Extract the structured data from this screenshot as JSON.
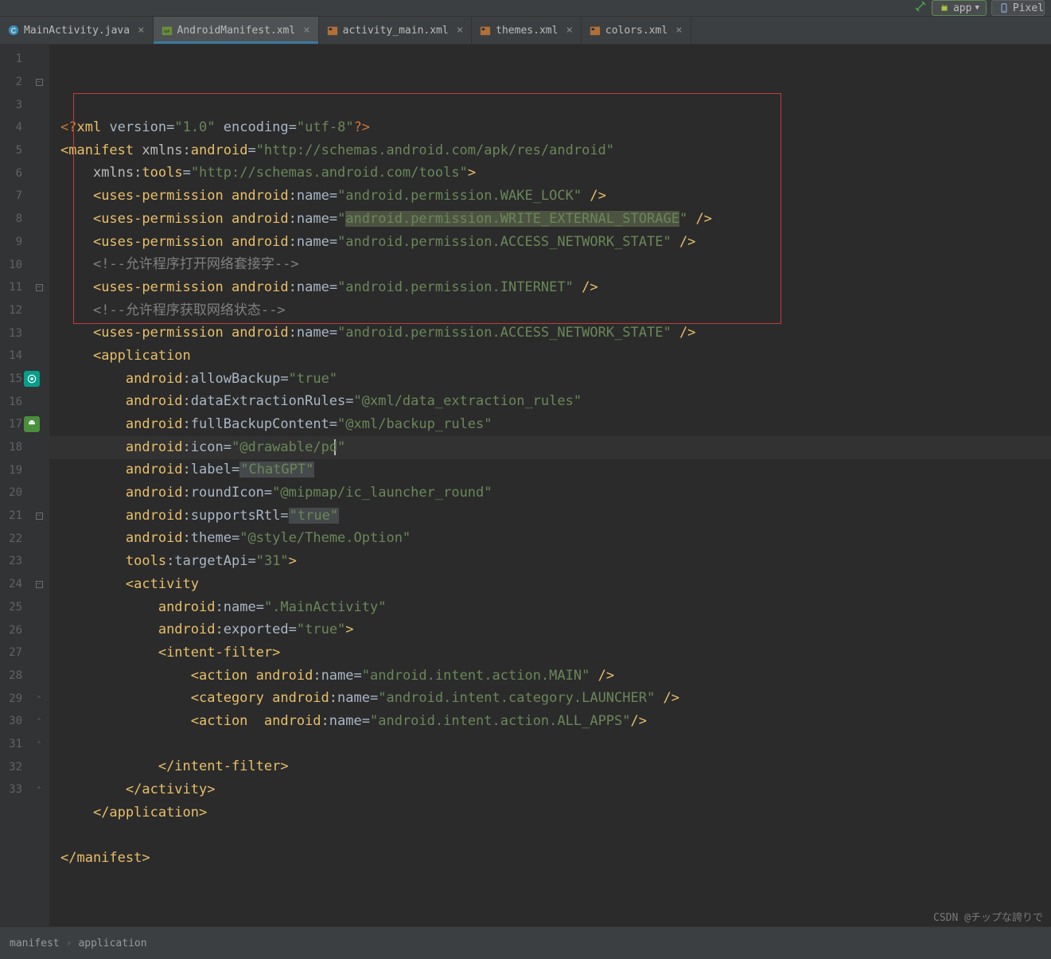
{
  "toolbar": {
    "config_label": "app",
    "device_label": "Pixel"
  },
  "tabs": [
    {
      "name": "MainActivity.java",
      "active": false
    },
    {
      "name": "AndroidManifest.xml",
      "active": true
    },
    {
      "name": "activity_main.xml",
      "active": false
    },
    {
      "name": "themes.xml",
      "active": false
    },
    {
      "name": "colors.xml",
      "active": false
    }
  ],
  "breadcrumb": [
    "manifest",
    "application"
  ],
  "watermark": "CSDN @チップな誇りで",
  "code": {
    "lines": [
      {
        "n": "1",
        "seg": [
          {
            "c": "decl",
            "t": "<?"
          },
          {
            "c": "tag",
            "t": "xml "
          },
          {
            "c": "attr",
            "t": "version"
          },
          {
            "c": "op",
            "t": "="
          },
          {
            "c": "str",
            "t": "\"1.0\""
          },
          {
            "c": "attr",
            "t": " encoding"
          },
          {
            "c": "op",
            "t": "="
          },
          {
            "c": "str",
            "t": "\"utf-8\""
          },
          {
            "c": "decl",
            "t": "?>"
          }
        ]
      },
      {
        "n": "2",
        "fold": "-",
        "seg": [
          {
            "c": "tag",
            "t": "<manifest "
          },
          {
            "c": "ns",
            "t": "xmlns:"
          },
          {
            "c": "tag",
            "t": "android"
          },
          {
            "c": "op",
            "t": "="
          },
          {
            "c": "str",
            "t": "\"http://schemas.android.com/apk/res/android\""
          }
        ]
      },
      {
        "n": "3",
        "seg": [
          {
            "c": "op",
            "t": "    "
          },
          {
            "c": "ns",
            "t": "xmlns:"
          },
          {
            "c": "tag",
            "t": "tools"
          },
          {
            "c": "op",
            "t": "="
          },
          {
            "c": "str",
            "t": "\"http://schemas.android.com/tools\""
          },
          {
            "c": "tag",
            "t": ">"
          }
        ]
      },
      {
        "n": "4",
        "seg": [
          {
            "c": "op",
            "t": "    "
          },
          {
            "c": "tag",
            "t": "<uses-permission "
          },
          {
            "c": "tag",
            "t": "android"
          },
          {
            "c": "ns",
            "t": ":"
          },
          {
            "c": "attr",
            "t": "name"
          },
          {
            "c": "op",
            "t": "="
          },
          {
            "c": "str",
            "t": "\"android.permission.WAKE_LOCK\""
          },
          {
            "c": "tag",
            "t": " />"
          }
        ]
      },
      {
        "n": "5",
        "seg": [
          {
            "c": "op",
            "t": "    "
          },
          {
            "c": "tag",
            "t": "<uses-permission "
          },
          {
            "c": "tag",
            "t": "android"
          },
          {
            "c": "ns",
            "t": ":"
          },
          {
            "c": "attr",
            "t": "name"
          },
          {
            "c": "op",
            "t": "="
          },
          {
            "c": "str",
            "t": "\""
          },
          {
            "c": "str",
            "t": "android.permission.WRITE_EXTERNAL_STORAGE",
            "hl": true
          },
          {
            "c": "str",
            "t": "\""
          },
          {
            "c": "tag",
            "t": " />"
          }
        ]
      },
      {
        "n": "6",
        "seg": [
          {
            "c": "op",
            "t": "    "
          },
          {
            "c": "tag",
            "t": "<uses-permission "
          },
          {
            "c": "tag",
            "t": "android"
          },
          {
            "c": "ns",
            "t": ":"
          },
          {
            "c": "attr",
            "t": "name"
          },
          {
            "c": "op",
            "t": "="
          },
          {
            "c": "str",
            "t": "\"android.permission.ACCESS_NETWORK_STATE\""
          },
          {
            "c": "tag",
            "t": " />"
          }
        ]
      },
      {
        "n": "7",
        "seg": [
          {
            "c": "op",
            "t": "    "
          },
          {
            "c": "comm",
            "t": "<!--允许程序打开网络套接字-->"
          }
        ]
      },
      {
        "n": "8",
        "seg": [
          {
            "c": "op",
            "t": "    "
          },
          {
            "c": "tag",
            "t": "<uses-permission "
          },
          {
            "c": "tag",
            "t": "android"
          },
          {
            "c": "ns",
            "t": ":"
          },
          {
            "c": "attr",
            "t": "name"
          },
          {
            "c": "op",
            "t": "="
          },
          {
            "c": "str",
            "t": "\"android.permission.INTERNET\""
          },
          {
            "c": "tag",
            "t": " />"
          }
        ]
      },
      {
        "n": "9",
        "seg": [
          {
            "c": "op",
            "t": "    "
          },
          {
            "c": "comm",
            "t": "<!--允许程序获取网络状态-->"
          }
        ]
      },
      {
        "n": "10",
        "seg": [
          {
            "c": "op",
            "t": "    "
          },
          {
            "c": "tag",
            "t": "<uses-permission "
          },
          {
            "c": "tag",
            "t": "android"
          },
          {
            "c": "ns",
            "t": ":"
          },
          {
            "c": "attr",
            "t": "name"
          },
          {
            "c": "op",
            "t": "="
          },
          {
            "c": "str",
            "t": "\"android.permission.ACCESS_NETWORK_STATE\""
          },
          {
            "c": "tag",
            "t": " />"
          }
        ]
      },
      {
        "n": "11",
        "fold": "-",
        "seg": [
          {
            "c": "op",
            "t": "    "
          },
          {
            "c": "tag",
            "t": "<application"
          }
        ]
      },
      {
        "n": "12",
        "seg": [
          {
            "c": "op",
            "t": "        "
          },
          {
            "c": "tag",
            "t": "android"
          },
          {
            "c": "ns",
            "t": ":"
          },
          {
            "c": "attr",
            "t": "allowBackup"
          },
          {
            "c": "op",
            "t": "="
          },
          {
            "c": "str",
            "t": "\"true\""
          }
        ]
      },
      {
        "n": "13",
        "seg": [
          {
            "c": "op",
            "t": "        "
          },
          {
            "c": "tag",
            "t": "android"
          },
          {
            "c": "ns",
            "t": ":"
          },
          {
            "c": "attr",
            "t": "dataExtractionRules"
          },
          {
            "c": "op",
            "t": "="
          },
          {
            "c": "str",
            "t": "\"@xml/data_extraction_rules\""
          }
        ]
      },
      {
        "n": "14",
        "seg": [
          {
            "c": "op",
            "t": "        "
          },
          {
            "c": "tag",
            "t": "android"
          },
          {
            "c": "ns",
            "t": ":"
          },
          {
            "c": "attr",
            "t": "fullBackupContent"
          },
          {
            "c": "op",
            "t": "="
          },
          {
            "c": "str",
            "t": "\"@xml/backup_rules\""
          }
        ]
      },
      {
        "n": "15",
        "icon": "teal",
        "seg": [
          {
            "c": "op",
            "t": "        "
          },
          {
            "c": "tag",
            "t": "android"
          },
          {
            "c": "ns",
            "t": ":"
          },
          {
            "c": "attr",
            "t": "icon"
          },
          {
            "c": "op",
            "t": "="
          },
          {
            "c": "str",
            "t": "\"@drawable/pd\""
          }
        ]
      },
      {
        "n": "16",
        "seg": [
          {
            "c": "op",
            "t": "        "
          },
          {
            "c": "tag",
            "t": "android"
          },
          {
            "c": "ns",
            "t": ":"
          },
          {
            "c": "attr",
            "t": "label"
          },
          {
            "c": "op",
            "t": "="
          },
          {
            "c": "str",
            "t": "\"ChatGPT\"",
            "label_hl": true
          }
        ]
      },
      {
        "n": "17",
        "icon": "green",
        "seg": [
          {
            "c": "op",
            "t": "        "
          },
          {
            "c": "tag",
            "t": "android"
          },
          {
            "c": "ns",
            "t": ":"
          },
          {
            "c": "attr",
            "t": "roundIcon"
          },
          {
            "c": "op",
            "t": "="
          },
          {
            "c": "str",
            "t": "\"@mipmap/ic_launcher_round\""
          }
        ]
      },
      {
        "n": "18",
        "current": true,
        "seg": [
          {
            "c": "op",
            "t": "        "
          },
          {
            "c": "tag",
            "t": "android"
          },
          {
            "c": "ns",
            "t": ":"
          },
          {
            "c": "attr",
            "t": "supportsRtl"
          },
          {
            "c": "op",
            "t": "="
          },
          {
            "c": "str",
            "t": "\"true\"",
            "label_hl": true
          }
        ]
      },
      {
        "n": "19",
        "seg": [
          {
            "c": "op",
            "t": "        "
          },
          {
            "c": "tag",
            "t": "android"
          },
          {
            "c": "ns",
            "t": ":"
          },
          {
            "c": "attr",
            "t": "theme"
          },
          {
            "c": "op",
            "t": "="
          },
          {
            "c": "str",
            "t": "\"@style/Theme.Option\""
          }
        ]
      },
      {
        "n": "20",
        "seg": [
          {
            "c": "op",
            "t": "        "
          },
          {
            "c": "tag",
            "t": "tools"
          },
          {
            "c": "ns",
            "t": ":"
          },
          {
            "c": "attr",
            "t": "targetApi"
          },
          {
            "c": "op",
            "t": "="
          },
          {
            "c": "str",
            "t": "\"31\""
          },
          {
            "c": "tag",
            "t": ">"
          }
        ]
      },
      {
        "n": "21",
        "fold": "-",
        "seg": [
          {
            "c": "op",
            "t": "        "
          },
          {
            "c": "tag",
            "t": "<activity"
          }
        ]
      },
      {
        "n": "22",
        "seg": [
          {
            "c": "op",
            "t": "            "
          },
          {
            "c": "tag",
            "t": "android"
          },
          {
            "c": "ns",
            "t": ":"
          },
          {
            "c": "attr",
            "t": "name"
          },
          {
            "c": "op",
            "t": "="
          },
          {
            "c": "str",
            "t": "\".MainActivity\""
          }
        ]
      },
      {
        "n": "23",
        "seg": [
          {
            "c": "op",
            "t": "            "
          },
          {
            "c": "tag",
            "t": "android"
          },
          {
            "c": "ns",
            "t": ":"
          },
          {
            "c": "attr",
            "t": "exported"
          },
          {
            "c": "op",
            "t": "="
          },
          {
            "c": "str",
            "t": "\"true\""
          },
          {
            "c": "tag",
            "t": ">"
          }
        ]
      },
      {
        "n": "24",
        "fold": "-",
        "seg": [
          {
            "c": "op",
            "t": "            "
          },
          {
            "c": "tag",
            "t": "<intent-filter>"
          }
        ]
      },
      {
        "n": "25",
        "seg": [
          {
            "c": "op",
            "t": "                "
          },
          {
            "c": "tag",
            "t": "<action "
          },
          {
            "c": "tag",
            "t": "android"
          },
          {
            "c": "ns",
            "t": ":"
          },
          {
            "c": "attr",
            "t": "name"
          },
          {
            "c": "op",
            "t": "="
          },
          {
            "c": "str",
            "t": "\"android.intent.action.MAIN\""
          },
          {
            "c": "tag",
            "t": " />"
          }
        ]
      },
      {
        "n": "26",
        "seg": [
          {
            "c": "op",
            "t": "                "
          },
          {
            "c": "tag",
            "t": "<category "
          },
          {
            "c": "tag",
            "t": "android"
          },
          {
            "c": "ns",
            "t": ":"
          },
          {
            "c": "attr",
            "t": "name"
          },
          {
            "c": "op",
            "t": "="
          },
          {
            "c": "str",
            "t": "\"android.intent.category.LAUNCHER\""
          },
          {
            "c": "tag",
            "t": " />"
          }
        ]
      },
      {
        "n": "27",
        "seg": [
          {
            "c": "op",
            "t": "                "
          },
          {
            "c": "tag",
            "t": "<action  "
          },
          {
            "c": "tag",
            "t": "android"
          },
          {
            "c": "ns",
            "t": ":"
          },
          {
            "c": "attr",
            "t": "name"
          },
          {
            "c": "op",
            "t": "="
          },
          {
            "c": "str",
            "t": "\"android.intent.action.ALL_APPS\""
          },
          {
            "c": "tag",
            "t": "/>"
          }
        ]
      },
      {
        "n": "28",
        "seg": [
          {
            "c": "op",
            "t": ""
          }
        ]
      },
      {
        "n": "29",
        "fold": "^",
        "seg": [
          {
            "c": "op",
            "t": "            "
          },
          {
            "c": "tag",
            "t": "</intent-filter>"
          }
        ]
      },
      {
        "n": "30",
        "fold": "^",
        "seg": [
          {
            "c": "op",
            "t": "        "
          },
          {
            "c": "tag",
            "t": "</activity>"
          }
        ]
      },
      {
        "n": "31",
        "fold": "^",
        "seg": [
          {
            "c": "op",
            "t": "    "
          },
          {
            "c": "tag",
            "t": "</application>"
          }
        ]
      },
      {
        "n": "32",
        "seg": [
          {
            "c": "op",
            "t": ""
          }
        ]
      },
      {
        "n": "33",
        "fold": "^",
        "seg": [
          {
            "c": "tag",
            "t": "</manifest>"
          }
        ]
      }
    ]
  }
}
